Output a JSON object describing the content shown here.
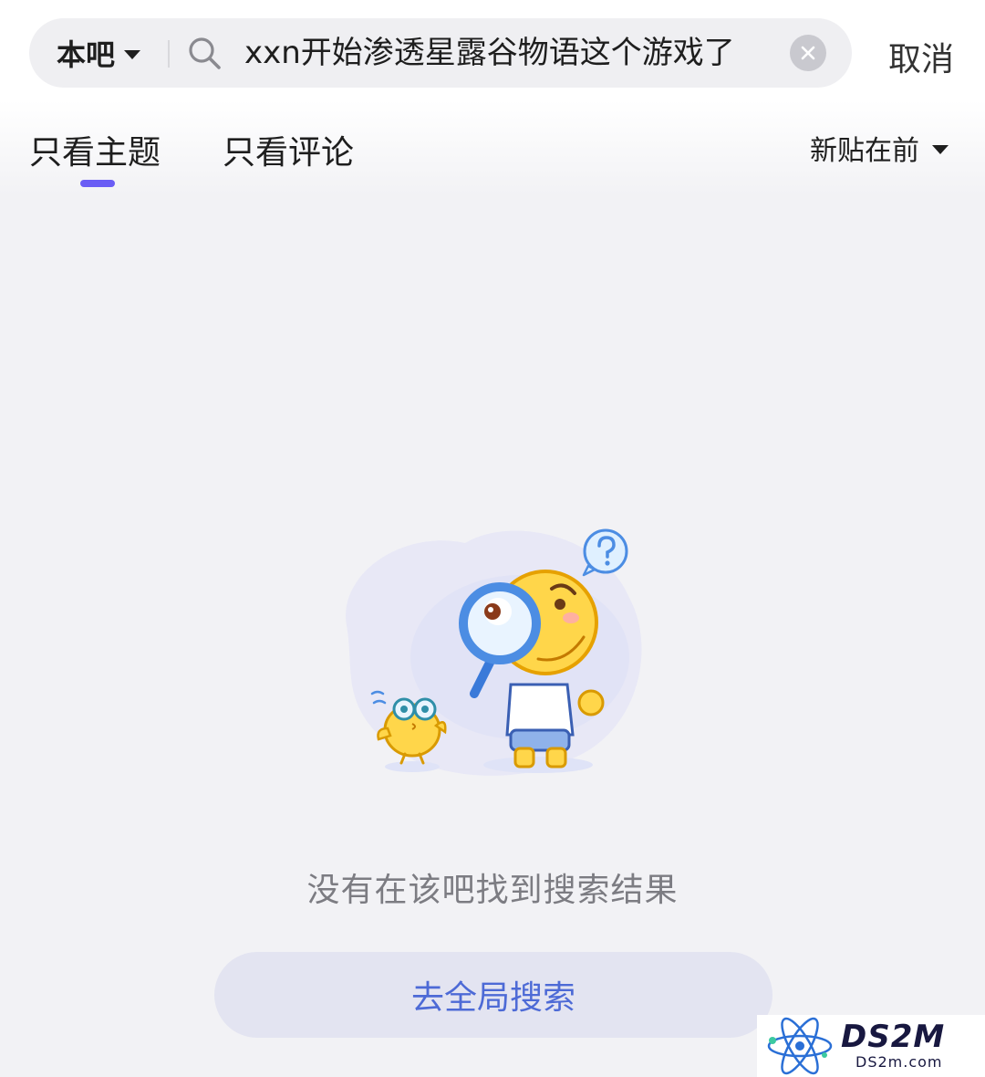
{
  "search": {
    "scope_label": "本吧",
    "query": "xxn开始渗透星露谷物语这个游戏了",
    "cancel_label": "取消"
  },
  "tabs": [
    {
      "label": "只看主题",
      "active": true
    },
    {
      "label": "只看评论",
      "active": false
    }
  ],
  "sort": {
    "label": "新贴在前"
  },
  "empty_state": {
    "message": "没有在该吧找到搜索结果",
    "button_label": "去全局搜索"
  },
  "watermark": {
    "title": "DS2M",
    "url": "DS2m.com"
  },
  "colors": {
    "accent": "#6a5df5",
    "button_bg": "#e3e4f1",
    "button_text": "#4d6ad6",
    "page_bg": "#f2f2f5"
  },
  "icons": [
    "chevron-down-icon",
    "search-icon",
    "clear-icon",
    "question-bubble-icon"
  ]
}
